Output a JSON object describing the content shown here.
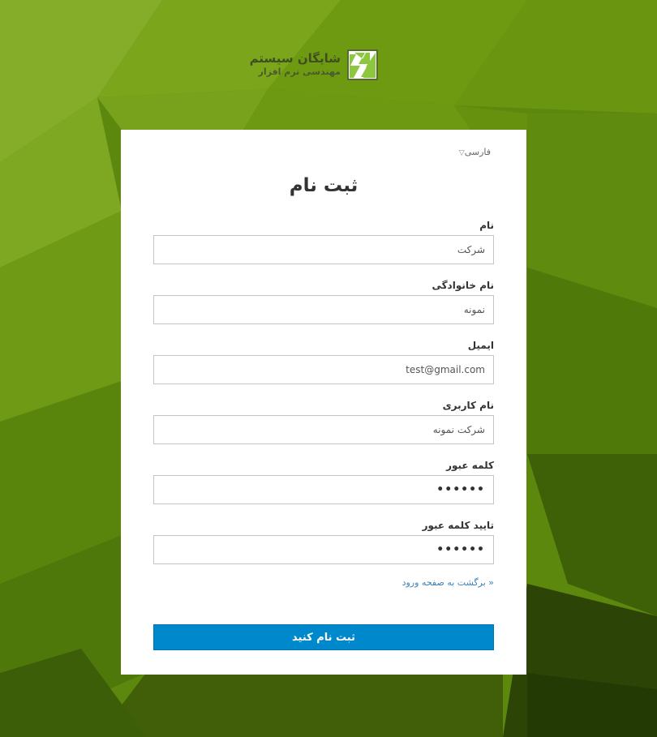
{
  "brand": {
    "name": "شایگان سیستم",
    "tagline": "مهندسی نرم افزار",
    "mark_color": "#8dc63f"
  },
  "language": {
    "label": "فارسی",
    "caret": "▽"
  },
  "form": {
    "title": "ثبت نام",
    "fields": [
      {
        "label": "نام",
        "value": "شرکت"
      },
      {
        "label": "نام خانوادگی",
        "value": "نمونه"
      },
      {
        "label": "ایمیل",
        "value": "test@gmail.com"
      },
      {
        "label": "نام کاربری",
        "value": "شرکت نمونه"
      },
      {
        "label": "کلمه عبور",
        "value": "••••••"
      },
      {
        "label": "تایید کلمه عبور",
        "value": "••••••"
      }
    ],
    "back_link": "« برگشت به صفحه ورود",
    "submit_label": "ثبت نام کنید"
  },
  "colors": {
    "background": "#5f8a10",
    "primary_button": "#0088cc",
    "link": "#3d83b8"
  }
}
